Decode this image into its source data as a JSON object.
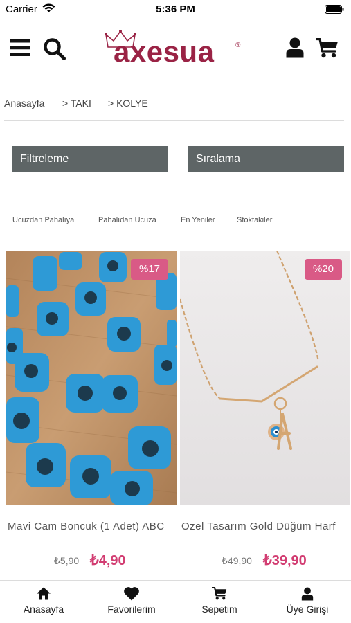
{
  "status_bar": {
    "carrier": "Carrier",
    "time": "5:36 PM"
  },
  "header": {
    "logo_text": "axesua",
    "logo_mark": "®",
    "icons": {
      "menu": "menu-icon",
      "search": "search-icon",
      "account": "user-icon",
      "cart": "cart-icon"
    }
  },
  "breadcrumb": {
    "items": [
      "Anasayfa",
      "> TAKI",
      "> KOLYE"
    ]
  },
  "controls": {
    "filter_label": "Filtreleme",
    "sort_label": "Sıralama"
  },
  "sort_options": [
    "Ucuzdan Pahalıya",
    "Pahalıdan Ucuza",
    "En Yeniler",
    "Stoktakiler"
  ],
  "products": [
    {
      "name": "Mavi Cam Boncuk (1 Adet) ABC",
      "badge": "%17",
      "old_price": "₺5,90",
      "new_price": "₺4,90"
    },
    {
      "name": "Ozel Tasarım Gold Düğüm Harf",
      "badge": "%20",
      "old_price": "₺49,90",
      "new_price": "₺39,90"
    }
  ],
  "tab_bar": {
    "items": [
      {
        "label": "Anasayfa",
        "icon": "home-icon"
      },
      {
        "label": "Favorilerim",
        "icon": "heart-icon"
      },
      {
        "label": "Sepetim",
        "icon": "cart-icon"
      },
      {
        "label": "Üye Girişi",
        "icon": "user-icon"
      }
    ]
  },
  "colors": {
    "brand": "#9a2345",
    "badge": "#d95a86",
    "price": "#d23d72",
    "button": "#5e6566"
  }
}
